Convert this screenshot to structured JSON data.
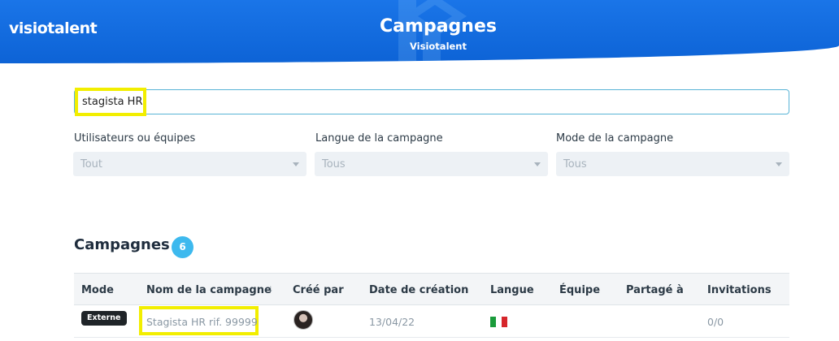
{
  "header": {
    "brand": "visiotalent",
    "title": "Campagnes",
    "subtitle": "Visiotalent"
  },
  "search": {
    "value": "stagista HR"
  },
  "filters": [
    {
      "label": "Utilisateurs ou équipes",
      "value": "Tout"
    },
    {
      "label": "Langue de la campagne",
      "value": "Tous"
    },
    {
      "label": "Mode de la campagne",
      "value": "Tous"
    }
  ],
  "section": {
    "title": "Campagnes",
    "count": "6"
  },
  "table": {
    "columns": [
      "Mode",
      "Nom de la campagne",
      "Créé par",
      "Date de création",
      "Langue",
      "Équipe",
      "Partagé à",
      "Invitations"
    ],
    "rows": [
      {
        "mode": "Externe",
        "name": "Stagista HR rif. 99999",
        "created_by": "avatar",
        "date": "13/04/22",
        "language_flag": "flag-italy-icon",
        "team": "",
        "shared_with": "",
        "invitations": "0/0"
      }
    ]
  },
  "colors": {
    "header_blue": "#0d63d6",
    "accent": "#3db9ee",
    "highlight": "#f2ee00",
    "flag": [
      "#1a9b3b",
      "#ffffff",
      "#d6262b"
    ]
  }
}
